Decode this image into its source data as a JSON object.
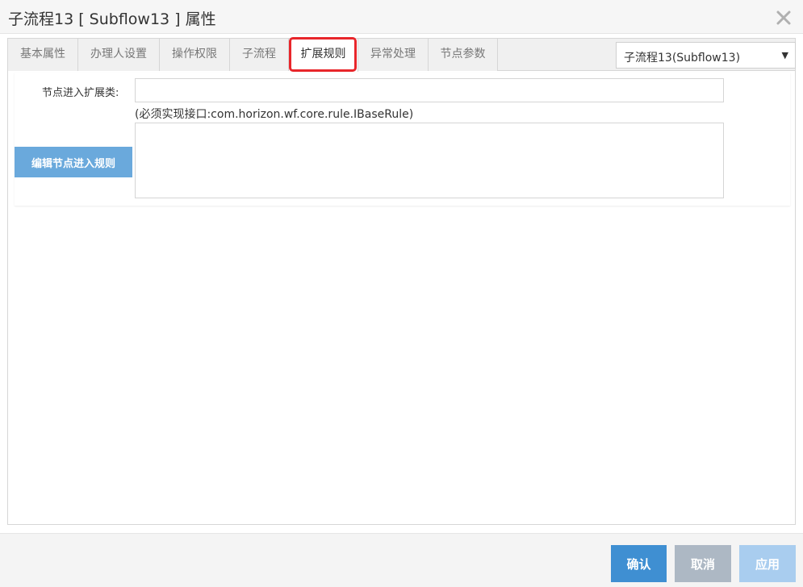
{
  "dialog": {
    "title": "子流程13 [ Subflow13 ] 属性"
  },
  "tabs": [
    {
      "label": "基本属性"
    },
    {
      "label": "办理人设置"
    },
    {
      "label": "操作权限"
    },
    {
      "label": "子流程"
    },
    {
      "label": "扩展规则",
      "active": true
    },
    {
      "label": "异常处理"
    },
    {
      "label": "节点参数"
    }
  ],
  "node_select": {
    "value": "子流程13(Subflow13)"
  },
  "form": {
    "class_label": "节点进入扩展类:",
    "class_value": "",
    "interface_hint": "(必须实现接口:com.horizon.wf.core.rule.IBaseRule)",
    "rule_text": "",
    "edit_rule_button": "编辑节点进入规则"
  },
  "footer": {
    "ok_label": "确认",
    "cancel_label": "取消",
    "apply_label": "应用"
  },
  "colors": {
    "highlight_border": "#e8262b",
    "primary_button": "#3f8fd2",
    "edit_button": "#6aa9dc"
  }
}
